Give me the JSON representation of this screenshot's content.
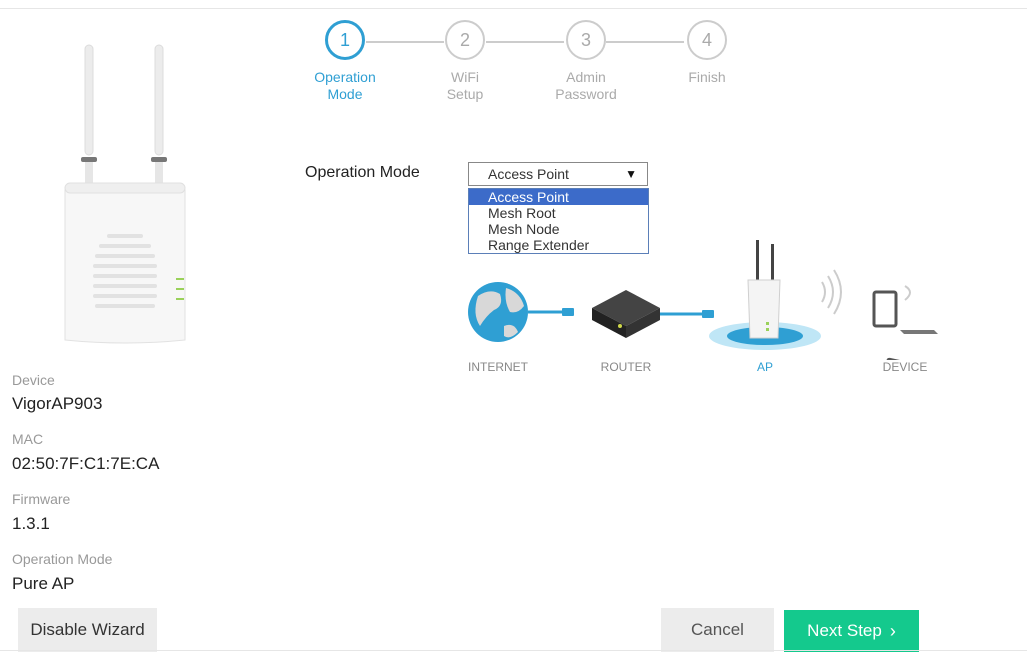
{
  "stepper": {
    "steps": [
      {
        "number": "1",
        "label": "Operation\nMode"
      },
      {
        "number": "2",
        "label": "WiFi\nSetup"
      },
      {
        "number": "3",
        "label": "Admin\nPassword"
      },
      {
        "number": "4",
        "label": "Finish"
      }
    ],
    "active_step": 1
  },
  "device_info": {
    "device_label": "Device",
    "device_value": "VigorAP903",
    "mac_label": "MAC",
    "mac_value": "02:50:7F:C1:7E:CA",
    "firmware_label": "Firmware",
    "firmware_value": "1.3.1",
    "opmode_label": "Operation Mode",
    "opmode_value": "Pure AP"
  },
  "form": {
    "operation_mode_label": "Operation Mode",
    "selected": "Access Point",
    "options": [
      "Access Point",
      "Mesh Root",
      "Mesh Node",
      "Range Extender"
    ]
  },
  "diagram": {
    "labels": [
      "INTERNET",
      "ROUTER",
      "AP",
      "DEVICE"
    ]
  },
  "buttons": {
    "disable": "Disable Wizard",
    "cancel": "Cancel",
    "next": "Next Step"
  },
  "colors": {
    "accent": "#2f9fd3",
    "next_button": "#14c98d",
    "selection": "#3c6bc9"
  }
}
